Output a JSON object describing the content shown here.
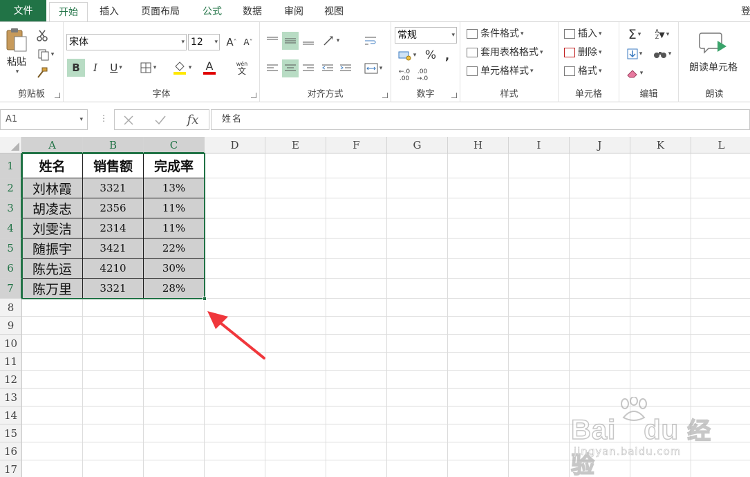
{
  "tabs": {
    "file": "文件",
    "home": "开始",
    "insert": "插入",
    "layout": "页面布局",
    "formulas": "公式",
    "data": "数据",
    "review": "审阅",
    "view": "视图",
    "overflow": "登"
  },
  "ribbon": {
    "clipboard": {
      "label": "剪贴板",
      "paste": "粘贴"
    },
    "font": {
      "label": "字体",
      "font_name": "宋体",
      "font_size": "12",
      "bold": "B",
      "italic": "I",
      "underline": "U",
      "color_glyph": "A",
      "grow": "A",
      "shrink": "A",
      "phonetic_top": "wén",
      "phonetic_bottom": "文"
    },
    "alignment": {
      "label": "对齐方式"
    },
    "number": {
      "label": "数字",
      "format": "常规",
      "percent": "%",
      "comma": ",",
      "inc_decimal_top": "←.0",
      "inc_decimal_bottom": ".00",
      "dec_decimal_top": ".00",
      "dec_decimal_bottom": "→.0"
    },
    "styles": {
      "label": "样式",
      "conditional": "条件格式",
      "table": "套用表格格式",
      "cell_styles": "单元格样式"
    },
    "cells": {
      "label": "单元格",
      "insert": "插入",
      "delete": "删除",
      "format": "格式"
    },
    "editing": {
      "label": "编辑",
      "sum": "Σ",
      "sort_top": "A",
      "sort_bottom": "Z"
    },
    "read": {
      "label": "朗读",
      "read_cell": "朗读单元格"
    }
  },
  "formula_bar": {
    "name_box": "A1",
    "fx": "fx",
    "content": "姓名"
  },
  "grid": {
    "columns": [
      "A",
      "B",
      "C",
      "D",
      "E",
      "F",
      "G",
      "H",
      "I",
      "J",
      "K",
      "L"
    ],
    "rows": [
      "1",
      "2",
      "3",
      "4",
      "5",
      "6",
      "7",
      "8",
      "9",
      "10",
      "11",
      "12",
      "13",
      "14",
      "15",
      "16",
      "17"
    ],
    "table": {
      "headers": [
        "姓名",
        "销售额",
        "完成率"
      ],
      "data": [
        [
          "刘林霞",
          "3321",
          "13%"
        ],
        [
          "胡凌志",
          "2356",
          "11%"
        ],
        [
          "刘雯洁",
          "2314",
          "11%"
        ],
        [
          "随振宇",
          "3421",
          "22%"
        ],
        [
          "陈先运",
          "4210",
          "30%"
        ],
        [
          "陈万里",
          "3321",
          "28%"
        ]
      ]
    }
  },
  "colors": {
    "accent": "#217346",
    "arrow": "#f0373c",
    "selection_fill": "#d0d0d0"
  },
  "watermark": {
    "brand": "Bai",
    "brand2": "du",
    "product": "经验",
    "url": "jingyan.baidu.com"
  }
}
